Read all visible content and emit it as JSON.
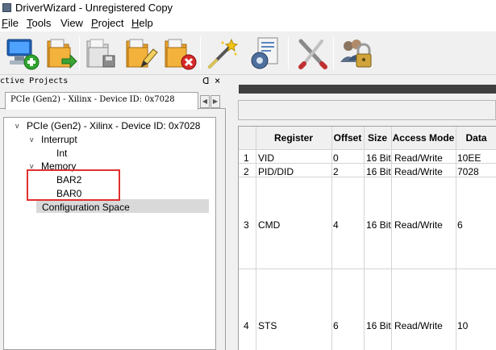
{
  "window": {
    "title": "DriverWizard - Unregistered Copy"
  },
  "menu": {
    "file_u": "F",
    "file_rest": "ile",
    "tools_u": "T",
    "tools_rest": "ools",
    "view": "View",
    "project_u": "P",
    "project_rest": "roject",
    "help_u": "H",
    "help_rest": "elp"
  },
  "toolbar": {
    "buttons": [
      {
        "icon": "new-device-icon"
      },
      {
        "icon": "open-folder-arrow-icon"
      },
      {
        "icon": "save-project-icon"
      },
      {
        "icon": "edit-project-icon"
      },
      {
        "icon": "close-project-icon"
      },
      {
        "icon": "wizard-wand-icon"
      },
      {
        "icon": "generate-code-icon"
      },
      {
        "icon": "tools-icon"
      },
      {
        "icon": "register-lock-icon"
      }
    ]
  },
  "left_panel": {
    "title": "Active Projects",
    "pin_glyph": "ᗡ",
    "close_glyph": "×",
    "tab_label": "PCIe (Gen2) - Xilinx - Device ID: 0x7028",
    "tab_prev": "◀",
    "tab_next": "▶",
    "tree": {
      "root": "PCIe (Gen2) - Xilinx - Device ID: 0x7028",
      "interrupt": "Interrupt",
      "int": "Int",
      "memory": "Memory",
      "bar2": "BAR2",
      "bar0": "BAR0",
      "config": "Configuration Space"
    },
    "chevron": "v"
  },
  "register_table": {
    "headers": [
      "Register",
      "Offset",
      "Size",
      "Access Mode",
      "Data"
    ],
    "rows": [
      {
        "num": "1",
        "register": "VID",
        "offset": "0",
        "size": "16 Bit",
        "access": "Read/Write",
        "data": "10EE"
      },
      {
        "num": "2",
        "register": "PID/DID",
        "offset": "2",
        "size": "16 Bit",
        "access": "Read/Write",
        "data": "7028"
      },
      {
        "num": "3",
        "register": "CMD",
        "offset": "4",
        "size": "16 Bit",
        "access": "Read/Write",
        "data": "6"
      },
      {
        "num": "4",
        "register": "STS",
        "offset": "6",
        "size": "16 Bit",
        "access": "Read/Write",
        "data": "10"
      }
    ]
  },
  "colors": {
    "highlight": "#e03030",
    "dark_bar": "#3f3f3f"
  }
}
